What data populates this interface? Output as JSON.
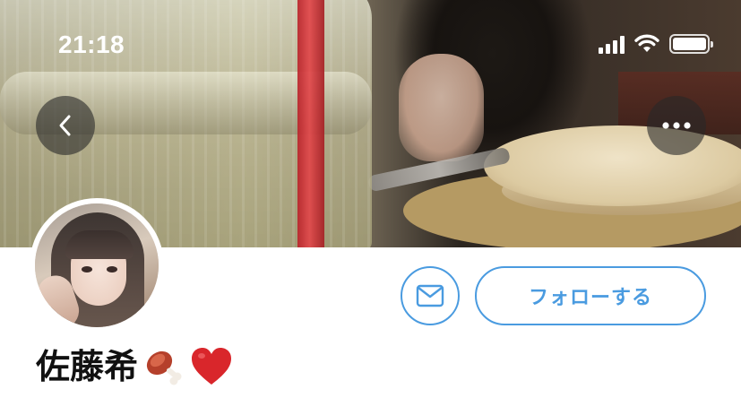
{
  "status_bar": {
    "time": "21:18",
    "icons": [
      "cellular-signal-icon",
      "wifi-icon",
      "battery-icon"
    ],
    "battery_level": 1.0
  },
  "header": {
    "back_icon": "chevron-left-icon",
    "more_icon": "more-horizontal-icon"
  },
  "profile": {
    "display_name": "佐藤希",
    "name_emojis": [
      "meat-on-bone-icon",
      "red-heart-icon"
    ]
  },
  "actions": {
    "message_icon": "envelope-icon",
    "follow_label": "フォローする"
  },
  "colors": {
    "accent": "#4a9be0",
    "text": "#111111",
    "background": "#ffffff",
    "heart": "#d9262b"
  }
}
